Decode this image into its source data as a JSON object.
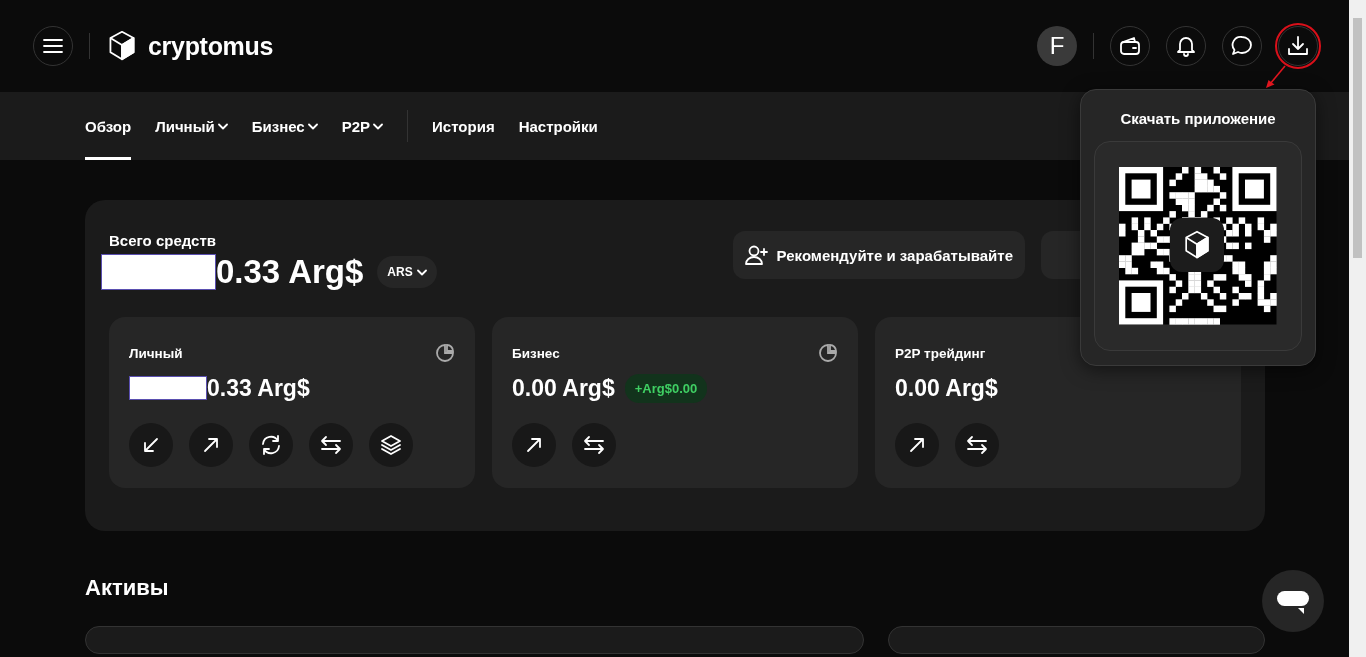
{
  "header": {
    "logo_text": "cryptomus",
    "avatar_letter": "F",
    "icon_buttons": [
      {
        "kind": "wallet",
        "highlighted": false
      },
      {
        "kind": "bell",
        "highlighted": false
      },
      {
        "kind": "chat",
        "highlighted": false
      },
      {
        "kind": "download",
        "highlighted": true
      }
    ]
  },
  "nav": {
    "main_tabs": [
      {
        "label": "Обзор",
        "selected": true,
        "dropdown": false
      },
      {
        "label": "Личный",
        "selected": false,
        "dropdown": true
      },
      {
        "label": "Бизнес",
        "selected": false,
        "dropdown": true
      },
      {
        "label": "P2P",
        "selected": false,
        "dropdown": true
      }
    ],
    "secondary_tabs": [
      {
        "label": "История",
        "selected": false,
        "dropdown": false
      },
      {
        "label": "Настройки",
        "selected": false,
        "dropdown": false
      }
    ]
  },
  "summary": {
    "title": "Всего средств",
    "amount": "0.33 Arg$",
    "redacted": true,
    "currency": "ARS",
    "refer_button": "Рекомендуйте и зарабатывайте"
  },
  "accounts": [
    {
      "name": "Личный",
      "amount": "0.33 Arg$",
      "redacted": true,
      "actions": [
        {
          "kind": "receive"
        },
        {
          "kind": "send"
        },
        {
          "kind": "exchange"
        },
        {
          "kind": "transfer"
        },
        {
          "kind": "stack"
        }
      ]
    },
    {
      "name": "Бизнес",
      "amount": "0.00 Arg$",
      "redacted": false,
      "badge": "+Arg$0.00",
      "actions": [
        {
          "kind": "send"
        },
        {
          "kind": "transfer"
        }
      ]
    },
    {
      "name": "P2P трейдинг",
      "amount": "0.00 Arg$",
      "redacted": false,
      "actions": [
        {
          "kind": "send"
        },
        {
          "kind": "transfer"
        }
      ]
    }
  ],
  "popover": {
    "title": "Скачать приложение"
  },
  "assets": {
    "title": "Активы"
  }
}
